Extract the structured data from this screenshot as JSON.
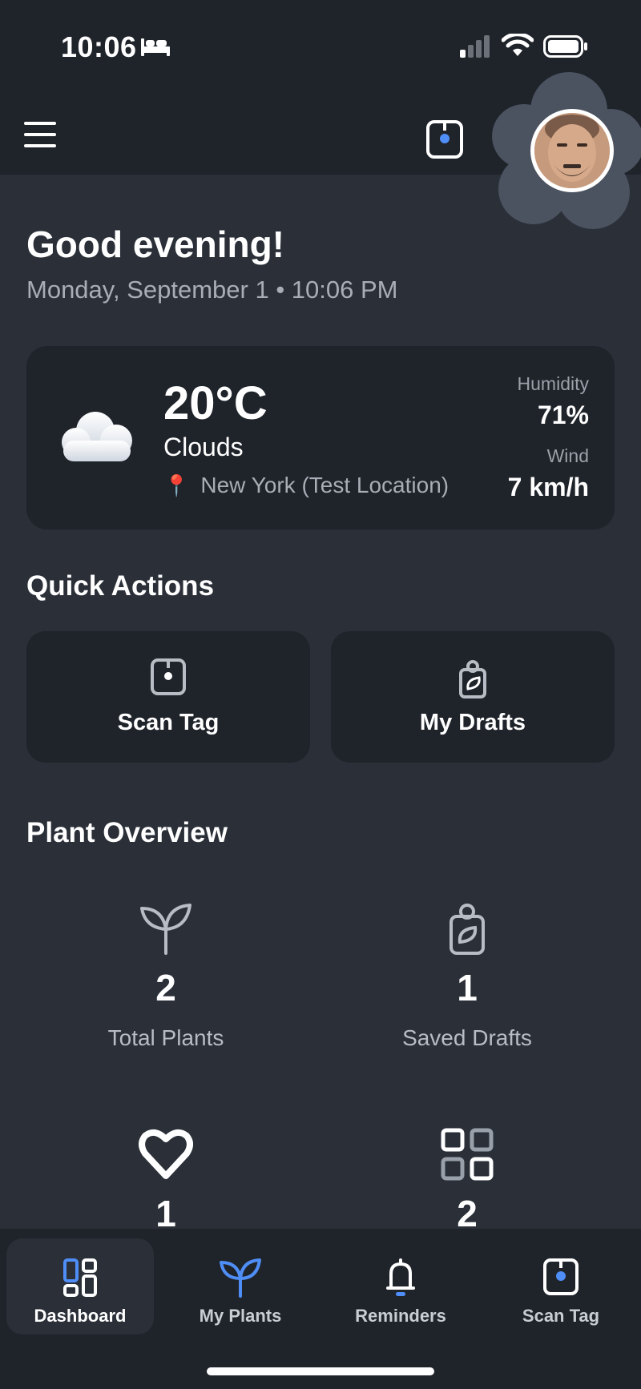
{
  "status_bar": {
    "time": "10:06"
  },
  "header": {
    "menu_icon": "hamburger-menu-icon",
    "scan_icon": "nfc-tag-icon"
  },
  "greeting": {
    "title": "Good evening!",
    "date_line": "Monday, September 1 • 10:06 PM"
  },
  "weather": {
    "icon": "cloud-icon",
    "temperature": "20°C",
    "condition": "Clouds",
    "location": "New York (Test Location)",
    "humidity_label": "Humidity",
    "humidity_value": "71%",
    "wind_label": "Wind",
    "wind_value": "7 km/h"
  },
  "quick_actions": {
    "title": "Quick Actions",
    "items": [
      {
        "label": "Scan Tag",
        "icon": "nfc-tag-icon"
      },
      {
        "label": "My Drafts",
        "icon": "seed-packet-icon"
      }
    ]
  },
  "overview": {
    "title": "Plant Overview",
    "stats": [
      {
        "value": "2",
        "label": "Total Plants",
        "icon": "sprout-icon"
      },
      {
        "value": "1",
        "label": "Saved Drafts",
        "icon": "seed-packet-icon"
      },
      {
        "value": "1",
        "label": "",
        "icon": "heart-icon"
      },
      {
        "value": "2",
        "label": "",
        "icon": "grid-icon"
      }
    ]
  },
  "tabs": [
    {
      "label": "Dashboard",
      "icon": "dashboard-icon",
      "active": true
    },
    {
      "label": "My Plants",
      "icon": "sprout-icon",
      "active": false
    },
    {
      "label": "Reminders",
      "icon": "bell-icon",
      "active": false
    },
    {
      "label": "Scan Tag",
      "icon": "nfc-tag-icon",
      "active": false
    }
  ],
  "colors": {
    "accent": "#4f8ef7",
    "background": "#2a2f38",
    "card": "#1f232a"
  }
}
